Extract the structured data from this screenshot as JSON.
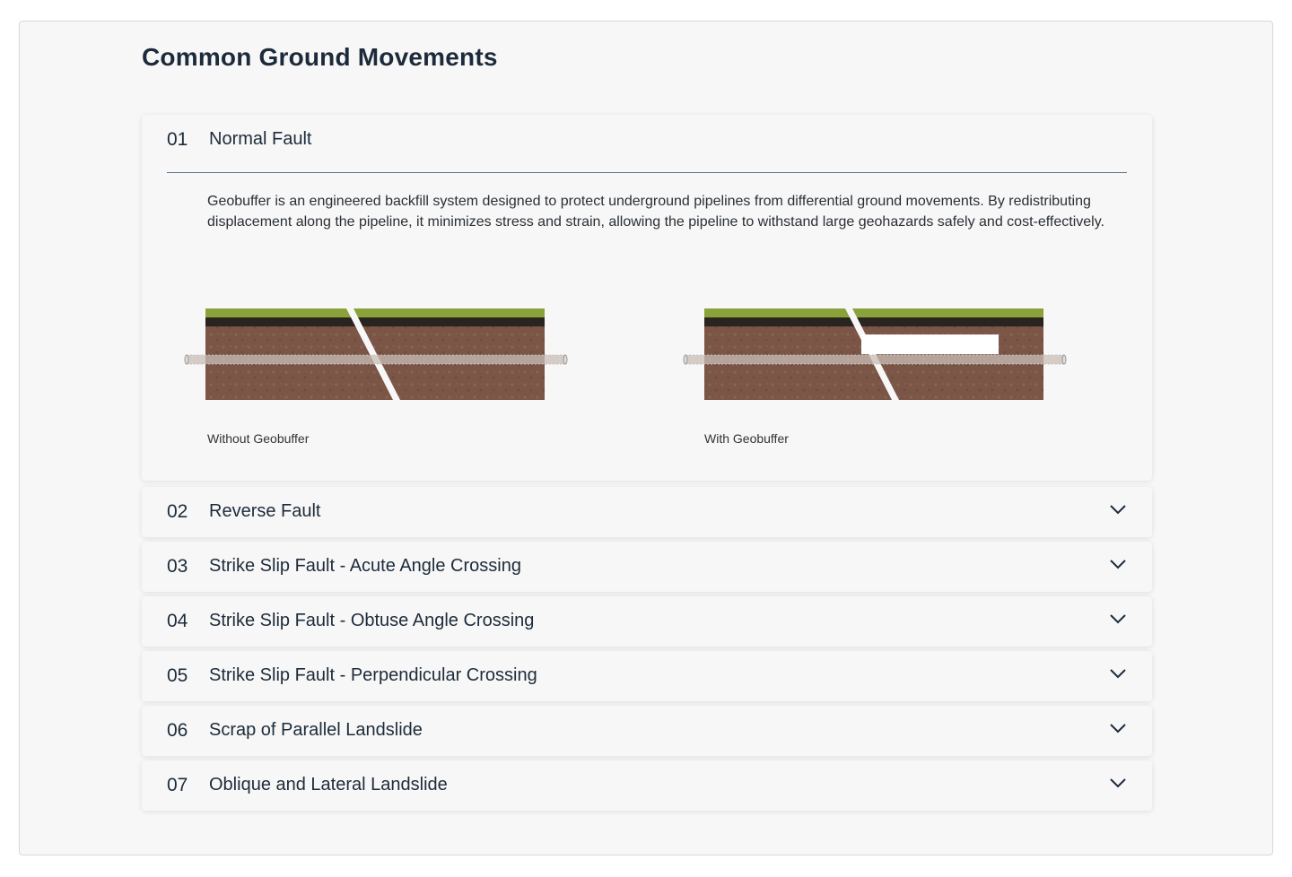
{
  "page": {
    "title": "Common Ground Movements"
  },
  "open_item": {
    "number": "01",
    "title": "Normal Fault",
    "description": "Geobuffer is an engineered backfill system designed to protect underground pipelines from differential ground movements. By redistributing displacement along the pipeline, it minimizes stress and strain, allowing the pipeline to withstand large geohazards safely and cost-effectively.",
    "diagrams": [
      {
        "caption": "Without Geobuffer"
      },
      {
        "caption": "With Geobuffer"
      }
    ]
  },
  "items": [
    {
      "number": "02",
      "title": "Reverse Fault"
    },
    {
      "number": "03",
      "title": "Strike Slip Fault - Acute Angle Crossing"
    },
    {
      "number": "04",
      "title": "Strike Slip Fault - Obtuse Angle Crossing"
    },
    {
      "number": "05",
      "title": "Strike Slip Fault - Perpendicular Crossing"
    },
    {
      "number": "06",
      "title": "Scrap of Parallel Landslide"
    },
    {
      "number": "07",
      "title": "Oblique and Lateral Landslide"
    }
  ],
  "colors": {
    "grass": "#8aa23a",
    "topsoil": "#2a2420",
    "soil": "#7b5647",
    "accent_line": "#5a728a",
    "chevron": "#1c2a3b"
  },
  "icons": {
    "expand": "chevron-down-icon"
  }
}
